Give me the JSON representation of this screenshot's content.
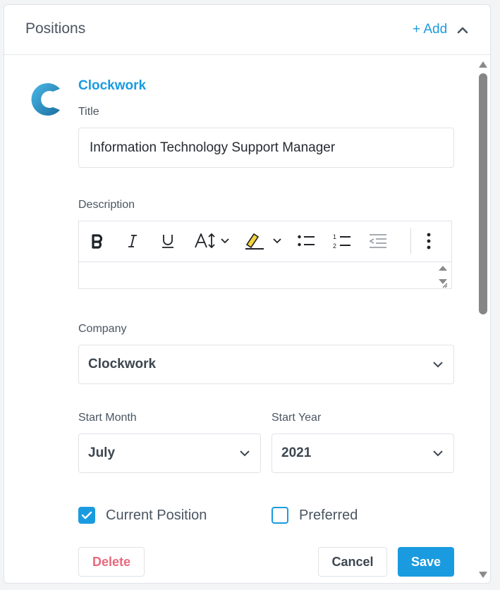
{
  "header": {
    "title": "Positions",
    "add_label": "+ Add"
  },
  "position": {
    "company_name": "Clockwork",
    "title_label": "Title",
    "title_value": "Information Technology Support Manager",
    "description_label": "Description",
    "company_label": "Company",
    "company_value": "Clockwork",
    "start_month_label": "Start Month",
    "start_month_value": "July",
    "start_year_label": "Start Year",
    "start_year_value": "2021",
    "current_position_label": "Current Position",
    "current_position_checked": true,
    "preferred_label": "Preferred",
    "preferred_checked": false
  },
  "toolbar": {
    "items": [
      "bold-icon",
      "italic-icon",
      "underline-icon",
      "font-size-icon",
      "highlight-icon",
      "bullet-list-icon",
      "numbered-list-icon",
      "outdent-icon",
      "more-icon"
    ]
  },
  "buttons": {
    "delete_label": "Delete",
    "cancel_label": "Cancel",
    "save_label": "Save"
  },
  "colors": {
    "accent": "#1a9be0",
    "danger": "#e8697d",
    "text": "#3c4650"
  }
}
